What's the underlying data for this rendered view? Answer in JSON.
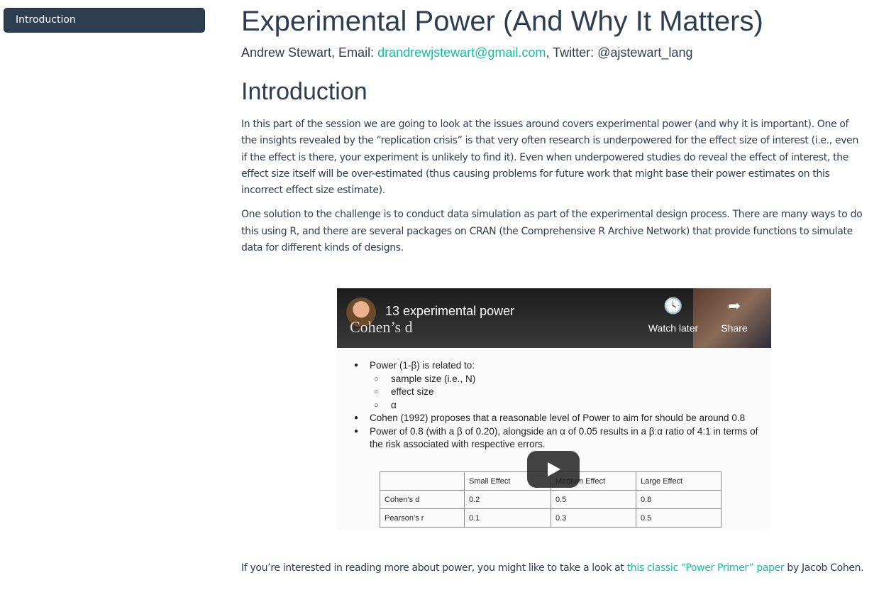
{
  "sidebar": {
    "toc": [
      {
        "label": "Introduction"
      }
    ]
  },
  "header": {
    "title": "Experimental Power (And Why It Matters)",
    "author_prefix": "Andrew Stewart, Email: ",
    "email": "drandrewjstewart@gmail.com",
    "twitter_text": ", Twitter: @ajstewart_lang"
  },
  "intro": {
    "heading": "Introduction",
    "p1": "In this part of the session we are going to look at the issues around covers experimental power (and why it is important). One of the insights revealed by the “replication crisis” is that very often research is underpowered for the effect size of interest (i.e., even if the effect is there, your experiment is unlikely to find it). Even when underpowered studies do reveal the effect of interest, the effect size itself will be over-estimated (thus causing problems for future work that might base their power estimates on this incorrect effect size estimate).",
    "p2": "One solution to the challenge is to conduct data simulation as part of the experimental design process. There are many ways to do this using R, and there are several packages on CRAN (the Comprehensive R Archive Network) that provide functions to simulate data for different kinds of designs."
  },
  "video": {
    "title": "13 experimental power",
    "slide_heading": "Cohen’s d",
    "watch_later": "Watch later",
    "share": "Share",
    "icons": {
      "watch_later": "clock-icon",
      "share": "share-arrow-icon",
      "play": "play-icon"
    },
    "bullets": [
      {
        "text": "Power (1-β) is related to:",
        "level": 1
      },
      {
        "text": "sample size (i.e., N)",
        "level": 2
      },
      {
        "text": "effect size",
        "level": 2
      },
      {
        "text": "α",
        "level": 2
      },
      {
        "text": "Cohen (1992) proposes that a reasonable level of Power to aim for should be around 0.8",
        "level": 1
      },
      {
        "text": "Power of 0.8 (with a β of 0.20), alongside an α of 0.05 results in a β:α ratio of 4:1 in terms of the risk associated with respective errors.",
        "level": 1
      }
    ],
    "table": {
      "headers": [
        "",
        "Small Effect",
        "Medium Effect",
        "Large Effect"
      ],
      "rows": [
        [
          "Cohen’s d",
          "0.2",
          "0.5",
          "0.8"
        ],
        [
          "Pearson’s r",
          "0.1",
          "0.3",
          "0.5"
        ]
      ]
    }
  },
  "footer_para": {
    "before": "If you’re interested in reading more about power, you might like to take a look at ",
    "link": "this classic “Power Primer” paper",
    "after": " by Jacob Cohen."
  }
}
